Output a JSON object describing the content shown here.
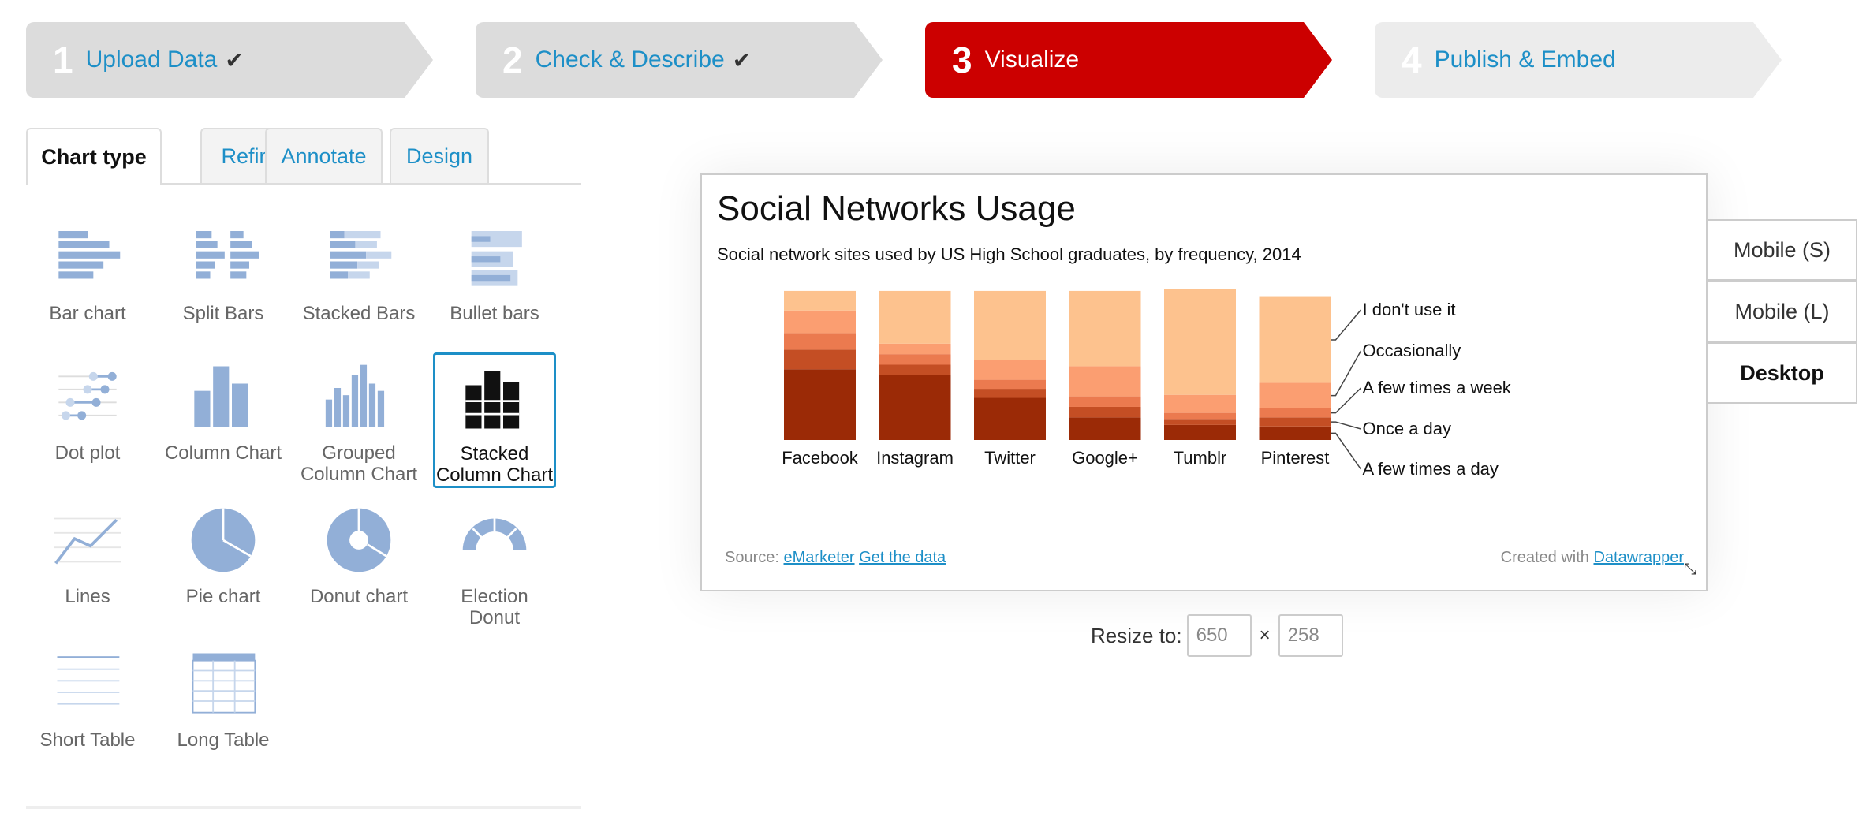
{
  "steps": [
    {
      "num": "1",
      "label": "Upload Data",
      "check": "✔"
    },
    {
      "num": "2",
      "label": "Check & Describe",
      "check": "✔"
    },
    {
      "num": "3",
      "label": "Visualize",
      "check": ""
    },
    {
      "num": "4",
      "label": "Publish & Embed",
      "check": ""
    }
  ],
  "tabs": [
    "Chart type",
    "Refine",
    "Annotate",
    "Design"
  ],
  "chart_types": [
    {
      "label": "Bar chart",
      "icon": "bar-chart-icon"
    },
    {
      "label": "Split Bars",
      "icon": "split-bars-icon"
    },
    {
      "label": "Stacked Bars",
      "icon": "stacked-bars-icon"
    },
    {
      "label": "Bullet bars",
      "icon": "bullet-bars-icon"
    },
    {
      "label": "Dot plot",
      "icon": "dot-plot-icon"
    },
    {
      "label": "Column Chart",
      "icon": "column-chart-icon"
    },
    {
      "label": "Grouped Column Chart",
      "icon": "grouped-column-icon"
    },
    {
      "label": "Stacked Column Chart",
      "icon": "stacked-column-icon"
    },
    {
      "label": "Lines",
      "icon": "lines-icon"
    },
    {
      "label": "Pie chart",
      "icon": "pie-chart-icon"
    },
    {
      "label": "Donut chart",
      "icon": "donut-chart-icon"
    },
    {
      "label": "Election Donut",
      "icon": "election-donut-icon"
    },
    {
      "label": "Short Table",
      "icon": "short-table-icon"
    },
    {
      "label": "Long Table",
      "icon": "long-table-icon"
    }
  ],
  "selected_chart_type": "Stacked Column Chart",
  "chart": {
    "title": "Social Networks Usage",
    "subtitle": "Social network sites used by US High School graduates, by frequency, 2014",
    "source_label": "Source:",
    "source_link": "eMarketer",
    "get_data": "Get the data",
    "created_with": "Created with",
    "created_link": "Datawrapper"
  },
  "chart_data": {
    "type": "bar",
    "stacked": true,
    "categories": [
      "Facebook",
      "Instagram",
      "Twitter",
      "Google+",
      "Tumblr",
      "Pinterest"
    ],
    "series": [
      {
        "name": "A few times a day",
        "color": "#9b2a06",
        "values": [
          47,
          43,
          28,
          15,
          10,
          9
        ]
      },
      {
        "name": "Once a day",
        "color": "#c44e24",
        "values": [
          13,
          7,
          6,
          7,
          4,
          6
        ]
      },
      {
        "name": "A few times a week",
        "color": "#eb7a4f",
        "values": [
          11,
          7,
          6,
          7,
          4,
          6
        ]
      },
      {
        "name": "Occasionally",
        "color": "#fb9e71",
        "values": [
          15,
          7,
          13,
          20,
          12,
          17
        ]
      },
      {
        "name": "I don't use it",
        "color": "#fdc28e",
        "values": [
          13,
          35,
          46,
          50,
          70,
          57
        ]
      }
    ],
    "ylim": [
      0,
      100
    ],
    "legend": "right-labels",
    "grid": false
  },
  "devices": [
    "Mobile (S)",
    "Mobile (L)",
    "Desktop"
  ],
  "active_device": "Desktop",
  "resize": {
    "label": "Resize to:",
    "width": "650",
    "height": "258",
    "x": "×"
  },
  "icons": {
    "check": "check-icon",
    "resize_handle": "resize-handle-icon"
  },
  "colors": {
    "accent": "#1d8fc7",
    "active_step": "#cc0000",
    "icon_blue": "#92afd7"
  }
}
